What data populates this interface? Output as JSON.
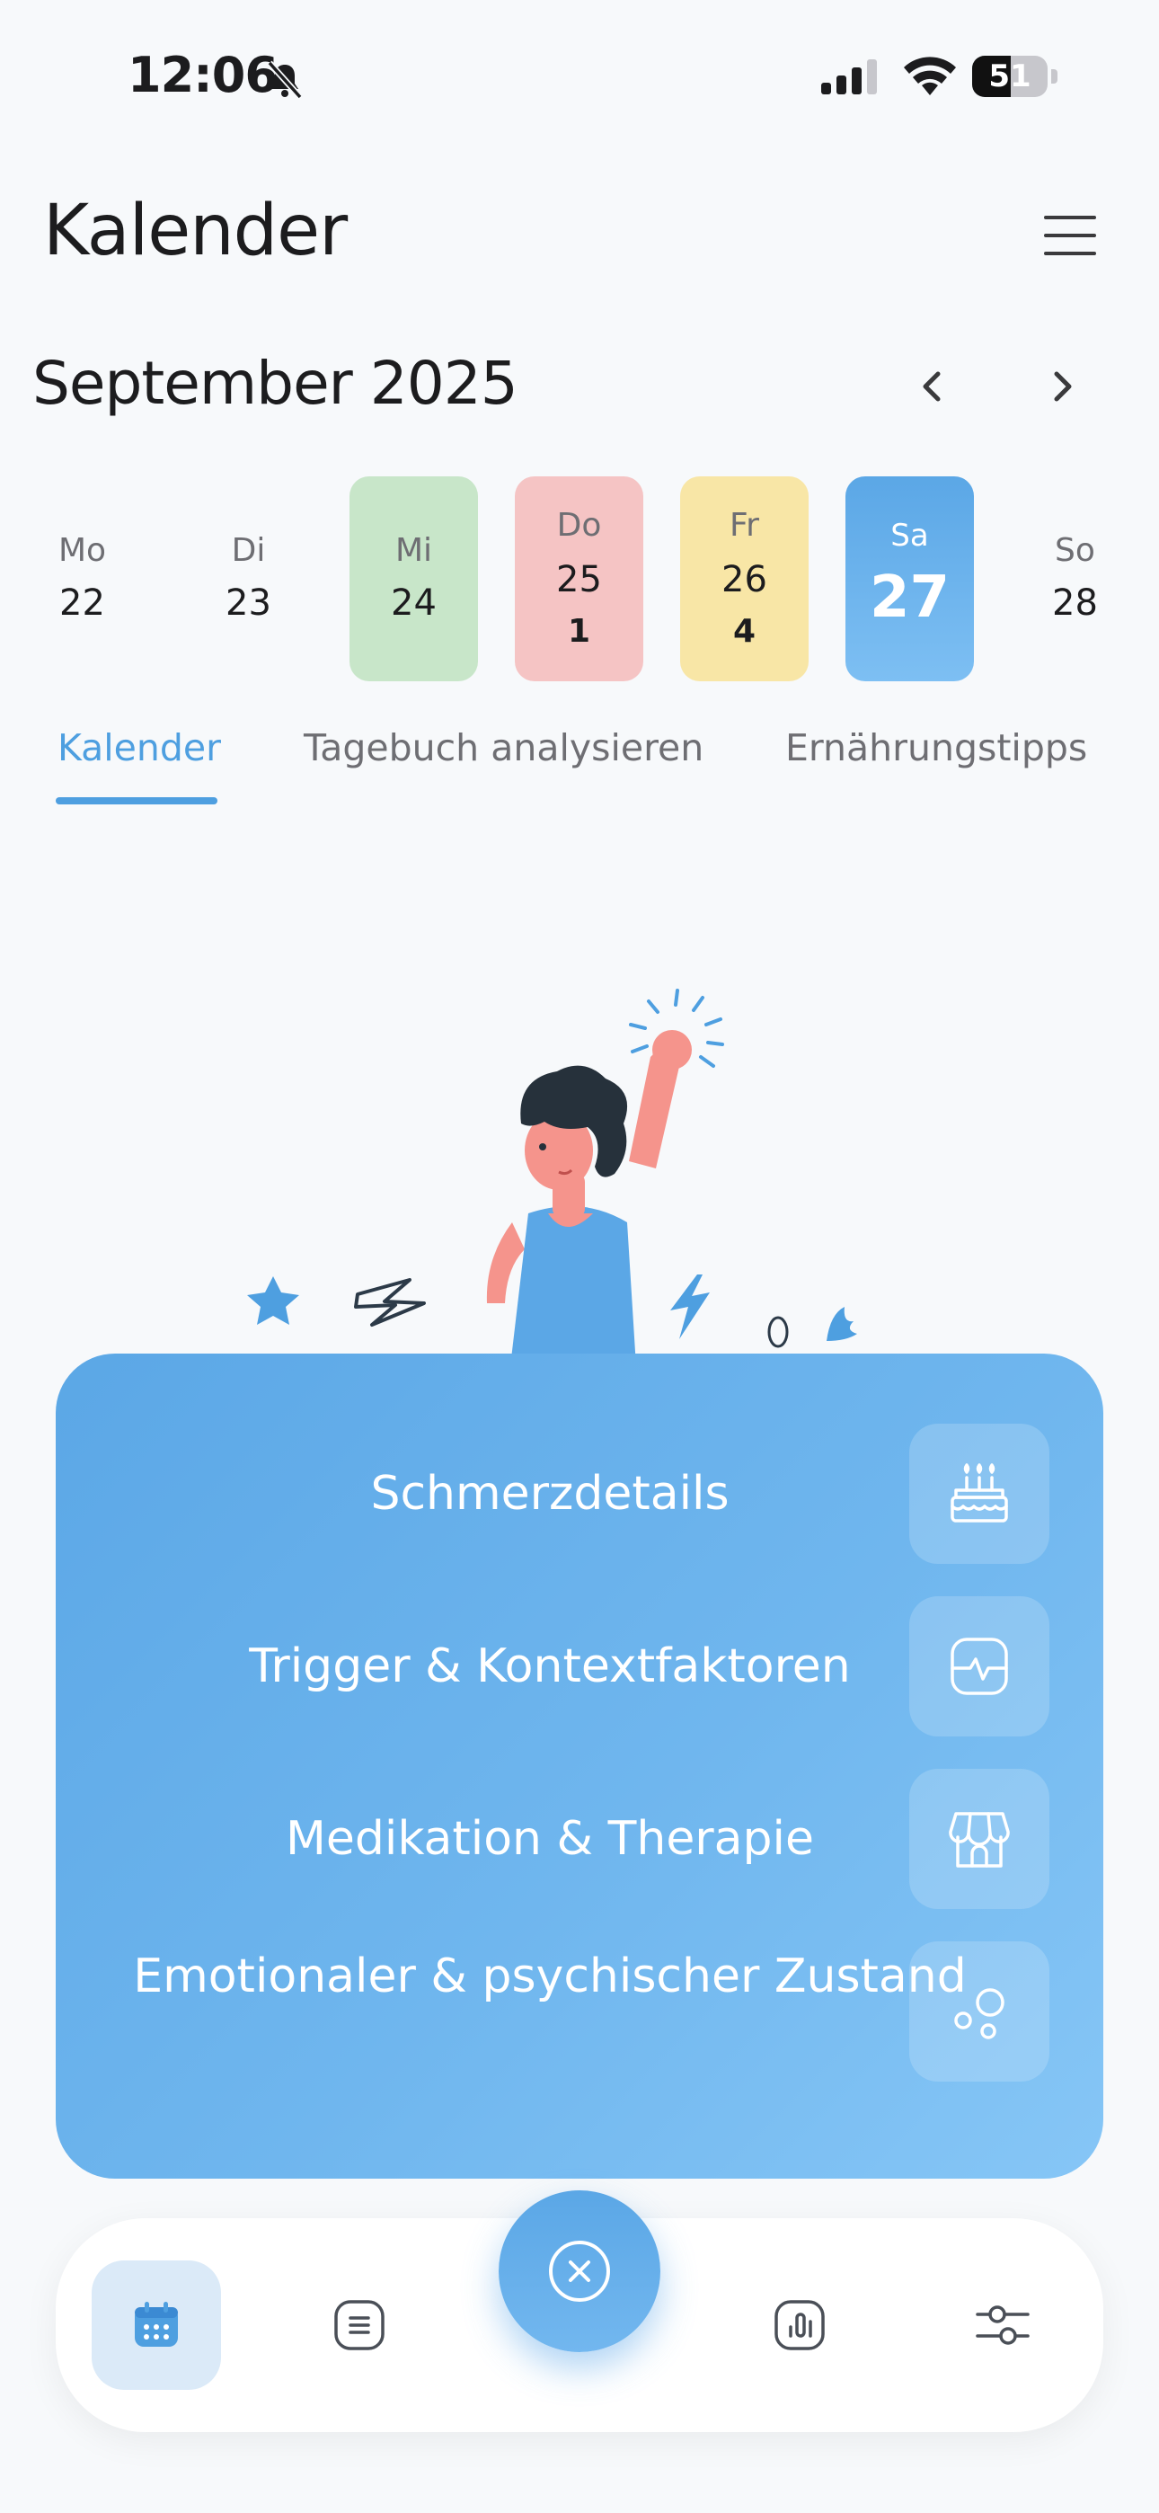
{
  "status_bar": {
    "time": "12:06",
    "battery": "51",
    "battery_level": 0.51
  },
  "header": {
    "title": "Kalender"
  },
  "calendar": {
    "month_label": "September 2025",
    "days": [
      {
        "name": "Mo",
        "number": "22",
        "count": "",
        "color": ""
      },
      {
        "name": "Di",
        "number": "23",
        "count": "",
        "color": ""
      },
      {
        "name": "Mi",
        "number": "24",
        "count": "",
        "color": "#c8e6c9"
      },
      {
        "name": "Do",
        "number": "25",
        "count": "1",
        "color": "#f5c4c4"
      },
      {
        "name": "Fr",
        "number": "26",
        "count": "4",
        "color": "#f8e6a6"
      },
      {
        "name": "Sa",
        "number": "27",
        "count": "",
        "color": "#5ba7e6",
        "selected": true
      },
      {
        "name": "So",
        "number": "28",
        "count": "",
        "color": ""
      }
    ]
  },
  "tabs": [
    {
      "label": "Kalender",
      "active": true
    },
    {
      "label": "Tagebuch analysieren",
      "active": false
    },
    {
      "label": "Ernährungstipps",
      "active": false
    }
  ],
  "menu": {
    "items": [
      {
        "label": "Schmerzdetails",
        "icon": "cake-icon"
      },
      {
        "label": "Trigger & Kontextfaktoren",
        "icon": "pulse-monitor-icon"
      },
      {
        "label": "Medikation & Therapie",
        "icon": "store-icon"
      },
      {
        "label": "Emotionaler & psychischer Zustand",
        "icon": "bubbles-icon"
      }
    ]
  },
  "bottom_nav": {
    "items": [
      {
        "icon": "calendar-icon",
        "active": true
      },
      {
        "icon": "notes-icon",
        "active": false
      },
      {
        "icon": "chart-icon",
        "active": false
      },
      {
        "icon": "sliders-icon",
        "active": false
      }
    ],
    "fab_icon": "close-circle-icon"
  },
  "colors": {
    "accent": "#5ba7e6",
    "background": "#f7f9fb"
  }
}
